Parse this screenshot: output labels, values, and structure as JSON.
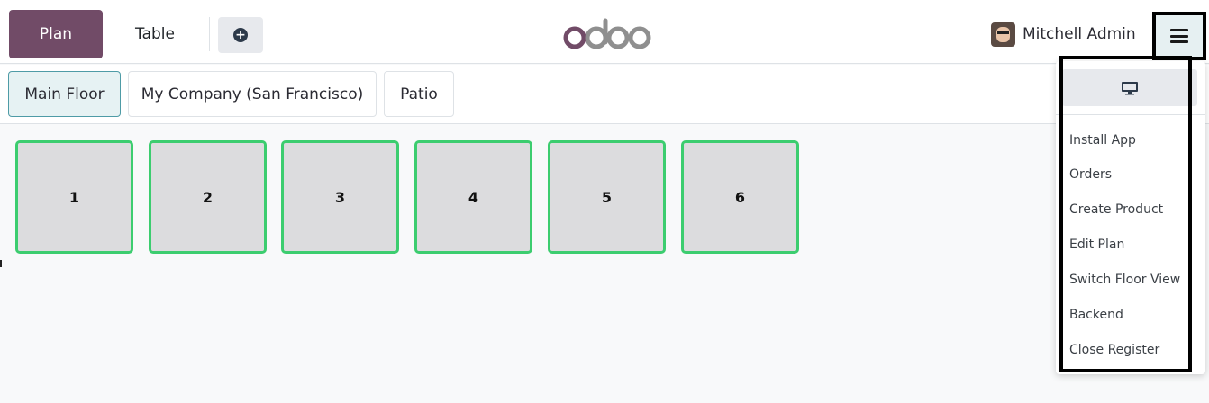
{
  "header": {
    "plan_label": "Plan",
    "table_label": "Table",
    "add_icon": "plus-circle-icon",
    "logo_text": "odoo",
    "user_name": "Mitchell Admin",
    "menu_icon": "hamburger-icon"
  },
  "floors": [
    {
      "label": "Main Floor",
      "active": true
    },
    {
      "label": "My Company (San Francisco)",
      "active": false
    },
    {
      "label": "Patio",
      "active": false
    }
  ],
  "tables": [
    "1",
    "2",
    "3",
    "4",
    "5",
    "6"
  ],
  "menu": {
    "monitor_icon": "monitor-icon",
    "items": [
      "Install App",
      "Orders",
      "Create Product",
      "Edit Plan",
      "Switch Floor View",
      "Backend",
      "Close Register"
    ]
  },
  "colors": {
    "brand": "#714b67",
    "table_border": "#3ccd6f",
    "table_fill": "#dcdcde",
    "active_floor": "#e6f2f3"
  }
}
